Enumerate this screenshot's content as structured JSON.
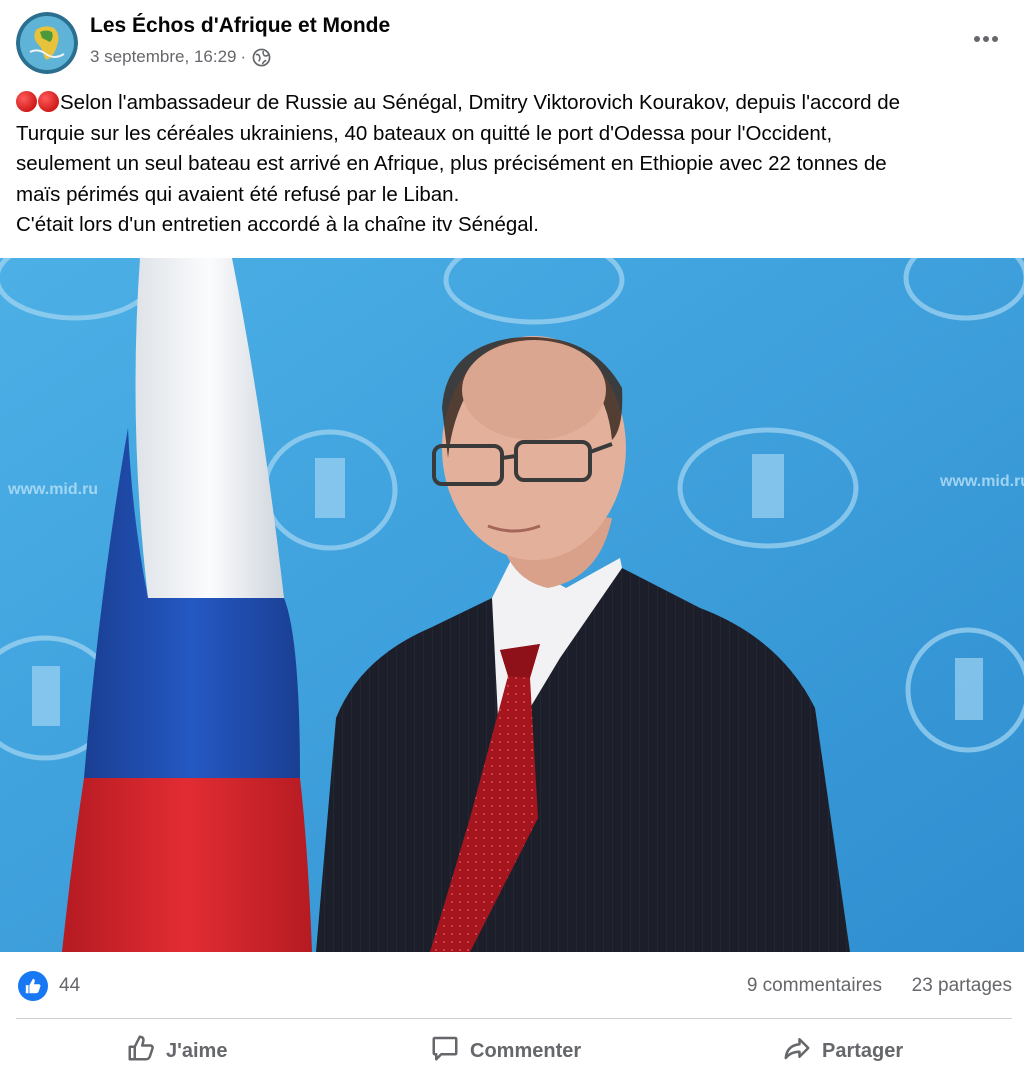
{
  "post": {
    "page_name": "Les Échos d'Afrique et Monde",
    "timestamp": "3 septembre, 16:29",
    "separator": "·",
    "privacy_icon": "globe-icon",
    "more_icon": "more-dots-icon",
    "emoji_prefix": "🔴🔴",
    "text_lines": [
      "Selon l'ambassadeur de Russie au Sénégal, Dmitry Viktorovich Kourakov, depuis l'accord de",
      "Turquie sur les céréales ukrainiens, 40 bateaux on quitté le port d'Odessa pour l'Occident,",
      "seulement un seul bateau est arrivé en Afrique, plus précisément en Ethiopie avec 22 tonnes de",
      "maïs périmés qui avaient été refusé par le Liban.",
      "C'était lors d'un entretien accordé à la chaîne itv Sénégal."
    ]
  },
  "photo": {
    "backdrop_watermark": "www.mid.ru",
    "colors": {
      "backdrop": "#3ea2dc",
      "flag_white": "#f4f6f8",
      "flag_blue": "#1f4fb0",
      "flag_red": "#d8262c"
    }
  },
  "stats": {
    "like_icon": "thumbs-up-icon",
    "like_count": "44",
    "comments": "9 commentaires",
    "shares": "23 partages"
  },
  "actions": {
    "like": "J'aime",
    "comment": "Commenter",
    "share": "Partager"
  },
  "colors": {
    "brand_blue": "#1877f2",
    "secondary_text": "#65676b",
    "divider": "#ced0d4"
  }
}
